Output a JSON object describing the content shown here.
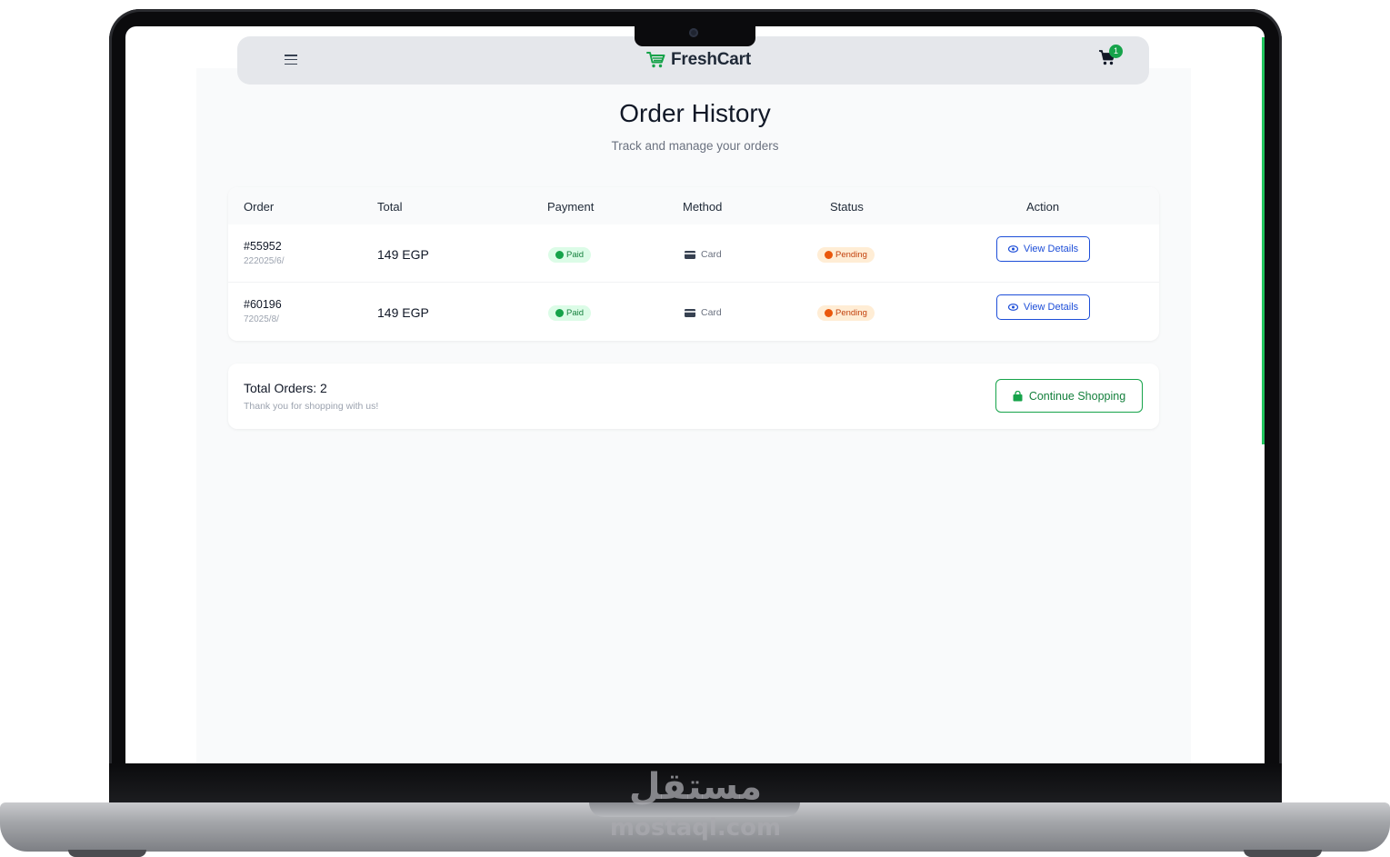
{
  "brand": {
    "name": "FreshCart",
    "color": "#16a34a"
  },
  "navbar": {
    "cart_count": "1"
  },
  "page": {
    "title": "Order History",
    "subtitle": "Track and manage your orders"
  },
  "orders_table": {
    "headers": [
      "Order",
      "Total",
      "Payment",
      "Method",
      "Status",
      "Action"
    ],
    "rows": [
      {
        "id": "#55952",
        "date": "222025/6/",
        "total": "149 EGP",
        "payment": "Paid",
        "method": "Card",
        "status": "Pending",
        "action": "View Details"
      },
      {
        "id": "#60196",
        "date": "72025/8/",
        "total": "149 EGP",
        "payment": "Paid",
        "method": "Card",
        "status": "Pending",
        "action": "View Details"
      }
    ]
  },
  "summary": {
    "total_orders": "Total Orders: 2",
    "thanks": "Thank you for shopping with us!",
    "continue_label": "Continue Shopping"
  },
  "colors": {
    "paid_bg": "#dcfce7",
    "paid_text": "#15803d",
    "pending_bg": "#ffedd5",
    "pending_text": "#c2410c",
    "view_button": "#1d4ed8",
    "continue_button": "#16a34a"
  },
  "watermark": {
    "arabic": "مستقل",
    "latin": "mostaql.com"
  }
}
